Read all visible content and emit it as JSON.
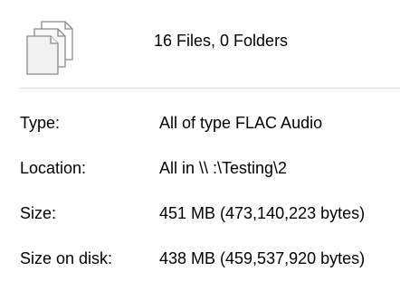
{
  "summary": {
    "text": "16 Files, 0 Folders",
    "icon": "multiple-documents-icon"
  },
  "properties": [
    {
      "label": "Type:",
      "value": "All of type FLAC Audio"
    },
    {
      "label": "Location:",
      "value": "All in \\\\                  :\\Testing\\2"
    },
    {
      "label": "Size:",
      "value": "451 MB (473,140,223 bytes)"
    },
    {
      "label": "Size on disk:",
      "value": "438 MB (459,537,920 bytes)"
    }
  ]
}
